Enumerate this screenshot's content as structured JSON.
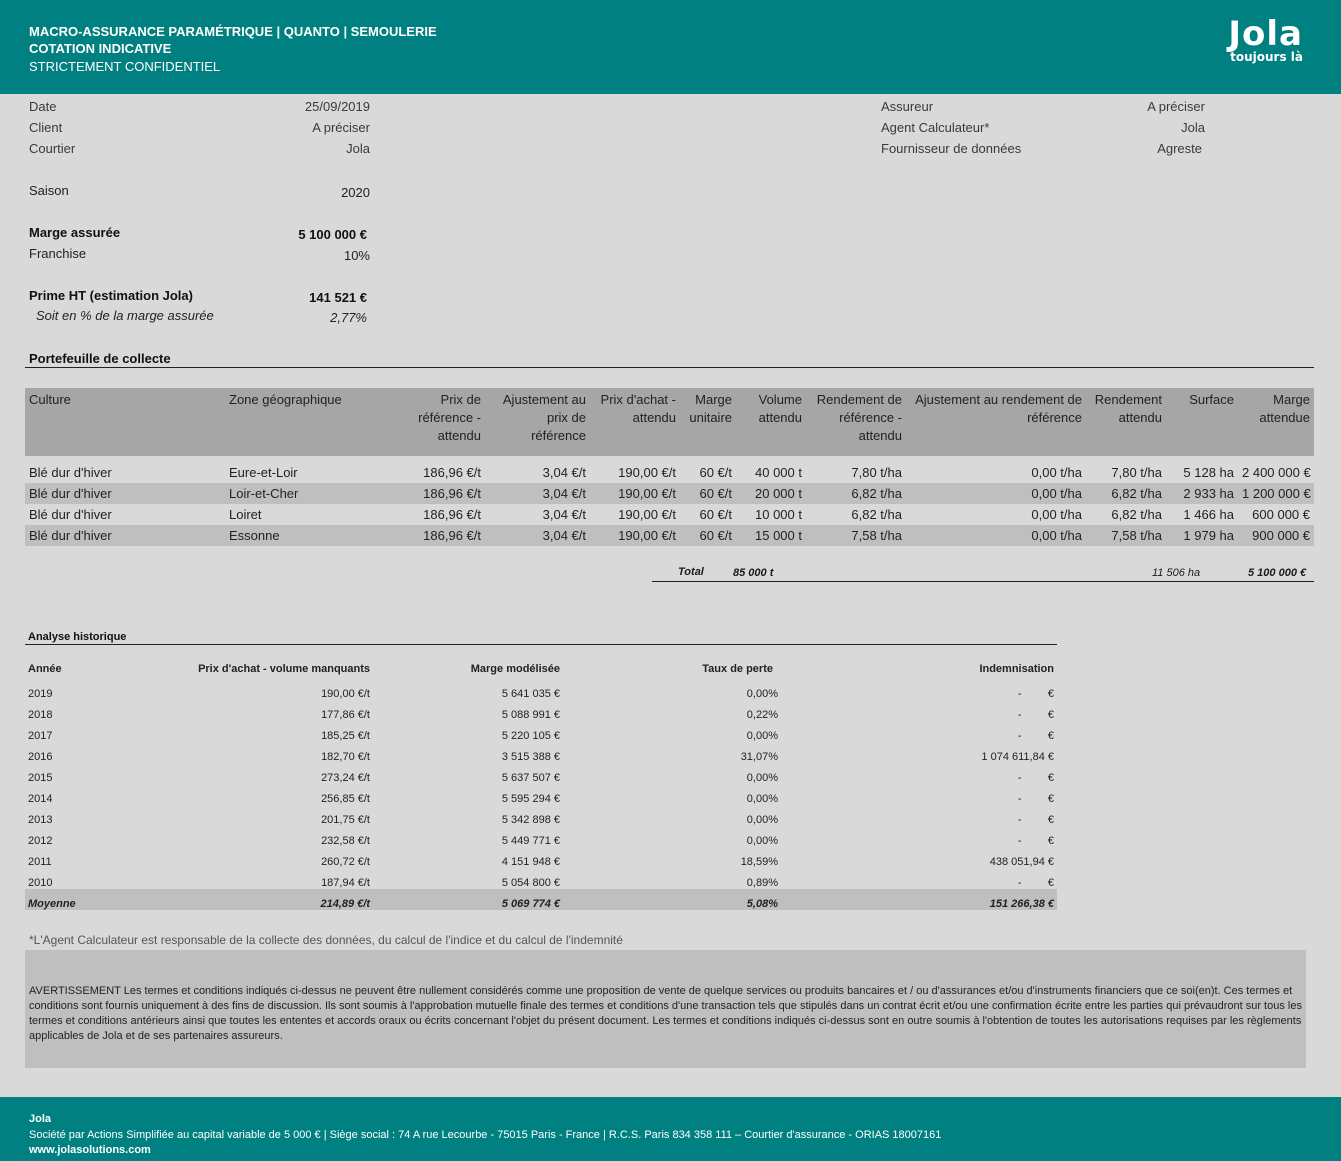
{
  "header": {
    "title_line1": "MACRO-ASSURANCE PARAMÉTRIQUE | QUANTO | SEMOULERIE",
    "title_line2": "COTATION INDICATIVE",
    "title_line3": "STRICTEMENT CONFIDENTIEL",
    "logo_name": "Jola",
    "logo_tagline": "toujours là",
    "brand_color": "#008080"
  },
  "info_left": {
    "date_label": "Date",
    "date_value": "25/09/2019",
    "client_label": "Client",
    "client_value": "A préciser",
    "courtier_label": "Courtier",
    "courtier_value": "Jola",
    "saison_label": "Saison",
    "saison_value": "2020",
    "marge_label": "Marge assurée",
    "marge_value": "5 100 000 €",
    "franchise_label": "Franchise",
    "franchise_value": "10%",
    "prime_label": "Prime HT (estimation Jola)",
    "prime_value": "141 521 €",
    "pct_label": "Soit en % de la  marge assurée",
    "pct_value": "2,77%"
  },
  "info_right": {
    "assureur_label": "Assureur",
    "assureur_value": "A préciser",
    "agent_label": "Agent Calculateur*",
    "agent_value": "Jola",
    "fournisseur_label": "Fournisseur de données",
    "fournisseur_value": "Agreste"
  },
  "portfolio": {
    "title": "Portefeuille de collecte",
    "headers": [
      "Culture",
      "Zone géographique",
      "Prix de référence - attendu",
      "Ajustement au prix de référence",
      "Prix d'achat - attendu",
      "Marge unitaire",
      "Volume attendu",
      "Rendement de référence - attendu",
      "Ajustement au rendement de référence",
      "Rendement attendu",
      "Surface",
      "Marge attendue"
    ],
    "rows": [
      [
        "Blé dur d'hiver",
        "Eure-et-Loir",
        "186,96 €/t",
        "3,04 €/t",
        "190,00 €/t",
        "60 €/t",
        "40 000 t",
        "7,80 t/ha",
        "0,00 t/ha",
        "7,80 t/ha",
        "5 128 ha",
        "2 400 000 €"
      ],
      [
        "Blé dur d'hiver",
        "Loir-et-Cher",
        "186,96 €/t",
        "3,04 €/t",
        "190,00 €/t",
        "60 €/t",
        "20 000 t",
        "6,82 t/ha",
        "0,00 t/ha",
        "6,82 t/ha",
        "2 933 ha",
        "1 200 000 €"
      ],
      [
        "Blé dur d'hiver",
        "Loiret",
        "186,96 €/t",
        "3,04 €/t",
        "190,00 €/t",
        "60 €/t",
        "10 000 t",
        "6,82 t/ha",
        "0,00 t/ha",
        "6,82 t/ha",
        "1 466 ha",
        "600 000 €"
      ],
      [
        "Blé dur d'hiver",
        "Essonne",
        "186,96 €/t",
        "3,04 €/t",
        "190,00 €/t",
        "60 €/t",
        "15 000 t",
        "7,58 t/ha",
        "0,00 t/ha",
        "7,58 t/ha",
        "1 979 ha",
        "900 000 €"
      ]
    ],
    "total_label": "Total",
    "total_volume": "85 000 t",
    "total_surface": "11 506 ha",
    "total_marge": "5 100 000 €"
  },
  "history": {
    "title": "Analyse historique",
    "headers": [
      "Année",
      "Prix d'achat - volume manquants",
      "Marge modélisée",
      "Taux de perte",
      "Indemnisation"
    ],
    "rows": [
      [
        "2019",
        "190,00 €/t",
        "5 641 035 €",
        "0,00%",
        "-",
        "€"
      ],
      [
        "2018",
        "177,86 €/t",
        "5 088 991 €",
        "0,22%",
        "-",
        "€"
      ],
      [
        "2017",
        "185,25 €/t",
        "5 220 105 €",
        "0,00%",
        "-",
        "€"
      ],
      [
        "2016",
        "182,70 €/t",
        "3 515 388 €",
        "31,07%",
        "1 074 611,84 €",
        ""
      ],
      [
        "2015",
        "273,24 €/t",
        "5 637 507 €",
        "0,00%",
        "-",
        "€"
      ],
      [
        "2014",
        "256,85 €/t",
        "5 595 294 €",
        "0,00%",
        "-",
        "€"
      ],
      [
        "2013",
        "201,75 €/t",
        "5 342 898 €",
        "0,00%",
        "-",
        "€"
      ],
      [
        "2012",
        "232,58 €/t",
        "5 449 771 €",
        "0,00%",
        "-",
        "€"
      ],
      [
        "2011",
        "260,72 €/t",
        "4 151 948 €",
        "18,59%",
        "438 051,94 €",
        ""
      ],
      [
        "2010",
        "187,94 €/t",
        "5 054 800 €",
        "0,89%",
        "-",
        "€"
      ]
    ],
    "avg": [
      "Moyenne",
      "214,89 €/t",
      "5 069 774 €",
      "5,08%",
      "151 266,38 €"
    ]
  },
  "footnote": "*L'Agent Calculateur est responsable de la collecte des données, du calcul de l'indice et du calcul de l'indemnité",
  "warning": "AVERTISSEMENT Les termes et conditions indiqués ci-dessus ne peuvent être nullement considérés comme une proposition de vente de quelque services ou produits bancaires et / ou d'assurances et/ou d'instruments financiers que ce soi(en)t. Ces termes et conditions sont fournis uniquement à des fins de discussion. Ils sont soumis à l'approbation mutuelle finale des termes et conditions d'une transaction tels que stipulés dans un contrat écrit et/ou une confirmation écrite entre les parties qui prévaudront sur tous les termes et conditions antérieurs ainsi que toutes les ententes et accords oraux ou écrits concernant l'objet du présent document. Les termes et conditions indiqués ci-dessus sont en outre soumis à l'obtention de toutes les autorisations requises par les règlements applicables de Jola et de ses partenaires assureurs.",
  "footer": {
    "company": "Jola",
    "legal": "Société par Actions Simplifiée au capital variable de 5 000 € | Siège social : 74 A rue Lecourbe - 75015 Paris - France | R.C.S. Paris 834 358 111 – Courtier d'assurance - ORIAS 18007161",
    "website": "www.jolasolutions.com"
  }
}
